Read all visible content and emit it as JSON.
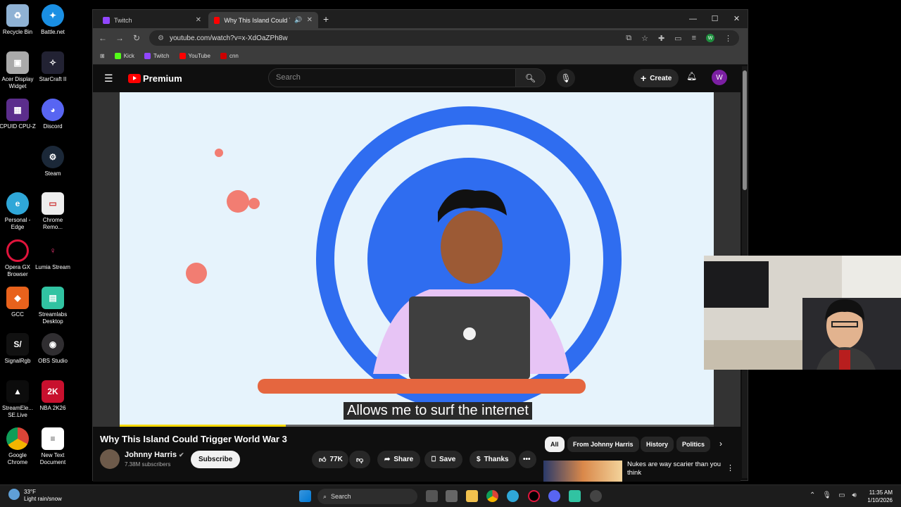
{
  "desktop": {
    "icons": [
      {
        "label": "Recycle Bin"
      },
      {
        "label": "Battle.net"
      },
      {
        "label": "Acer Display Widget"
      },
      {
        "label": "StarCraft II"
      },
      {
        "label": "CPUID CPU-Z"
      },
      {
        "label": "Discord"
      },
      {
        "label": "Steam"
      },
      {
        "label": "Personal - Edge"
      },
      {
        "label": "Chrome Remo..."
      },
      {
        "label": "Opera GX Browser"
      },
      {
        "label": "Lumia Stream"
      },
      {
        "label": "GCC"
      },
      {
        "label": "Streamlabs Desktop"
      },
      {
        "label": "SignalRgb"
      },
      {
        "label": "OBS Studio"
      },
      {
        "label": "StreamEle... SE.Live"
      },
      {
        "label": "NBA 2K26"
      },
      {
        "label": "Google Chrome"
      },
      {
        "label": "New Text Document"
      }
    ]
  },
  "browser": {
    "tabs": [
      {
        "label": "Twitch"
      },
      {
        "label": "Why This Island Could Trigg"
      }
    ],
    "url": "youtube.com/watch?v=x-XdOaZPh8w",
    "bookmarks": [
      "Kick",
      "Twitch",
      "YouTube",
      "cnn"
    ],
    "profile_initial": "W"
  },
  "youtube": {
    "logo_text": "Premium",
    "search_placeholder": "Search",
    "create_label": "Create",
    "avatar_initial": "W",
    "caption": "Allows me to surf the internet",
    "progress": 0.28,
    "video_title": "Why This Island Could Trigger World War 3",
    "channel_name": "Johnny Harris",
    "subscribers": "7.38M subscribers",
    "subscribe_label": "Subscribe",
    "likes": "77K",
    "share_label": "Share",
    "save_label": "Save",
    "thanks_label": "Thanks",
    "chips": [
      "All",
      "From Johnny Harris",
      "History",
      "Politics"
    ],
    "recommended_title": "Nukes are way scarier than you think"
  },
  "taskbar": {
    "weather_temp": "33°F",
    "weather_desc": "Light rain/snow",
    "search_label": "Search",
    "time": "11:35 AM",
    "date": "1/10/2026"
  },
  "colors": {
    "yt_red": "#ff0000",
    "video_bg": "#e6f3fc",
    "ring_blue": "#2f6df0",
    "progress": "#f5d800"
  }
}
